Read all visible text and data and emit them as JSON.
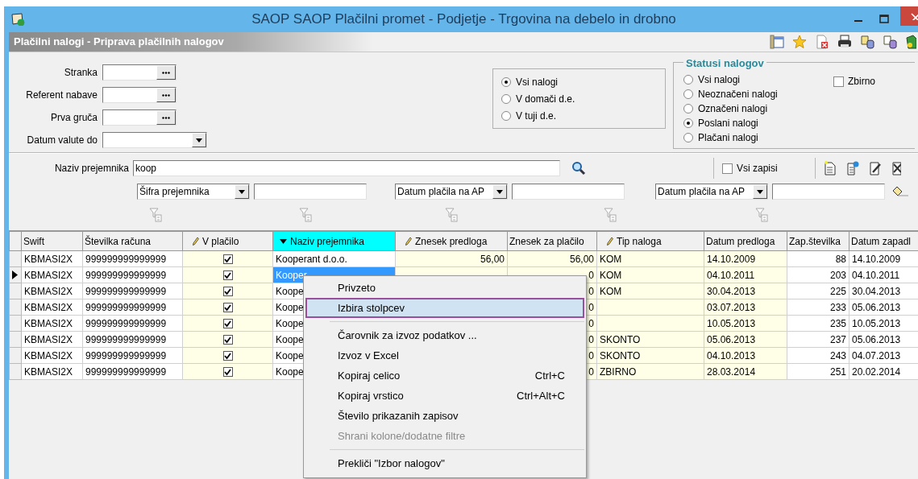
{
  "window": {
    "title": "SAOP SAOP Plačilni promet - Podjetje - Trgovina na debelo in drobno"
  },
  "subtitle": "Plačilni nalogi - Priprava plačilnih nalogov",
  "filters": [
    {
      "label": "Stranka",
      "kind": "lookup"
    },
    {
      "label": "Referent nabave",
      "kind": "lookup"
    },
    {
      "label": "Prva gruča",
      "kind": "lookup"
    },
    {
      "label": "Datum valute do",
      "kind": "dropdown"
    }
  ],
  "scope": [
    {
      "label": "Vsi nalogi",
      "selected": true
    },
    {
      "label": "V domači d.e.",
      "selected": false
    },
    {
      "label": "V tuji d.e.",
      "selected": false
    }
  ],
  "status_group": {
    "title": "Statusi nalogov",
    "options": [
      {
        "label": "Vsi nalogi",
        "selected": false
      },
      {
        "label": "Neoznačeni nalogi",
        "selected": false
      },
      {
        "label": "Označeni nalogi",
        "selected": false
      },
      {
        "label": "Poslani nalogi",
        "selected": true
      },
      {
        "label": "Plačani nalogi",
        "selected": false
      }
    ]
  },
  "zbirno": {
    "label": "Zbirno",
    "checked": false
  },
  "search": {
    "label": "Naziv prejemnika",
    "value": "koop"
  },
  "vsi_zapisi": {
    "label": "Vsi zapisi",
    "checked": false
  },
  "extra_filters": [
    "Šifra prejemnika",
    "Datum plačila na AP",
    "Datum plačila na AP"
  ],
  "table": {
    "columns": [
      {
        "label": "Swift",
        "kind": "plain"
      },
      {
        "label": "Številka računa",
        "kind": "plain"
      },
      {
        "label": "V plačilo",
        "kind": "editable"
      },
      {
        "label": "Naziv prejemnika",
        "kind": "sorted"
      },
      {
        "label": "Znesek predloga",
        "kind": "editable"
      },
      {
        "label": "Znesek za plačilo",
        "kind": "plain"
      },
      {
        "label": "Tip naloga",
        "kind": "editable"
      },
      {
        "label": "Datum predloga",
        "kind": "plain"
      },
      {
        "label": "Zap.številka",
        "kind": "plain"
      },
      {
        "label": "Datum zapadl",
        "kind": "plain"
      }
    ],
    "rows": [
      {
        "selected": false,
        "swift": "KBMASI2X",
        "account": "999999999999999",
        "checked": true,
        "name": "Kooperant d.o.o.",
        "amount": "56,00",
        "amount_to_pay": "56,00",
        "type": "KOM",
        "date": "14.10.2009",
        "seq": "88",
        "due_date": "14.10.2009"
      },
      {
        "selected": true,
        "swift": "KBMASI2X",
        "account": "999999999999999",
        "checked": true,
        "name": "Kooper",
        "amount_to_pay": "0",
        "type": "KOM",
        "date": "04.10.2011",
        "seq": "203",
        "due_date": "04.10.2011"
      },
      {
        "selected": false,
        "swift": "KBMASI2X",
        "account": "999999999999999",
        "checked": true,
        "name": "Koope",
        "amount_to_pay": "0",
        "type": "KOM",
        "date": "30.04.2013",
        "seq": "225",
        "due_date": "30.04.2013"
      },
      {
        "selected": false,
        "swift": "KBMASI2X",
        "account": "999999999999999",
        "checked": true,
        "name": "Koope",
        "amount_to_pay": "0",
        "date": "03.07.2013",
        "seq": "233",
        "due_date": "05.06.2013"
      },
      {
        "selected": false,
        "swift": "KBMASI2X",
        "account": "999999999999999",
        "checked": true,
        "name": "Koope",
        "amount_to_pay": "0",
        "date": "10.05.2013",
        "seq": "235",
        "due_date": "10.05.2013"
      },
      {
        "selected": false,
        "swift": "KBMASI2X",
        "account": "999999999999999",
        "checked": true,
        "name": "Koope",
        "amount_to_pay": "0",
        "type": "SKONTO",
        "date": "05.06.2013",
        "seq": "237",
        "due_date": "05.06.2013"
      },
      {
        "selected": false,
        "swift": "KBMASI2X",
        "account": "999999999999999",
        "checked": true,
        "name": "Koope",
        "amount_to_pay": "0",
        "type": "SKONTO",
        "date": "04.10.2013",
        "seq": "243",
        "due_date": "04.07.2013"
      },
      {
        "selected": false,
        "swift": "KBMASI2X",
        "account": "999999999999999",
        "checked": true,
        "name": "Koope",
        "amount_to_pay": "0",
        "type": "ZBIRNO",
        "date": "28.03.2014",
        "seq": "251",
        "due_date": "20.02.2014"
      }
    ]
  },
  "context_menu": [
    {
      "label": "Privzeto",
      "selected": false,
      "disabled": false
    },
    {
      "label": "Izbira stolpcev",
      "selected": true,
      "disabled": false
    },
    {
      "label": "Čarovnik za izvoz podatkov ...",
      "selected": false,
      "disabled": false,
      "separator_before": true
    },
    {
      "label": "Izvoz v Excel",
      "selected": false,
      "disabled": false
    },
    {
      "label": "Kopiraj celico",
      "shortcut": "Ctrl+C",
      "selected": false,
      "disabled": false
    },
    {
      "label": "Kopiraj vrstico",
      "shortcut": "Ctrl+Alt+C",
      "selected": false,
      "disabled": false
    },
    {
      "label": "Število prikazanih zapisov",
      "selected": false,
      "disabled": false
    },
    {
      "label": "Shrani kolone/dodatne filtre",
      "selected": false,
      "disabled": true
    },
    {
      "label": "Prekliči \"Izbor nalogov\"",
      "selected": false,
      "disabled": false,
      "separator_before": true
    }
  ]
}
